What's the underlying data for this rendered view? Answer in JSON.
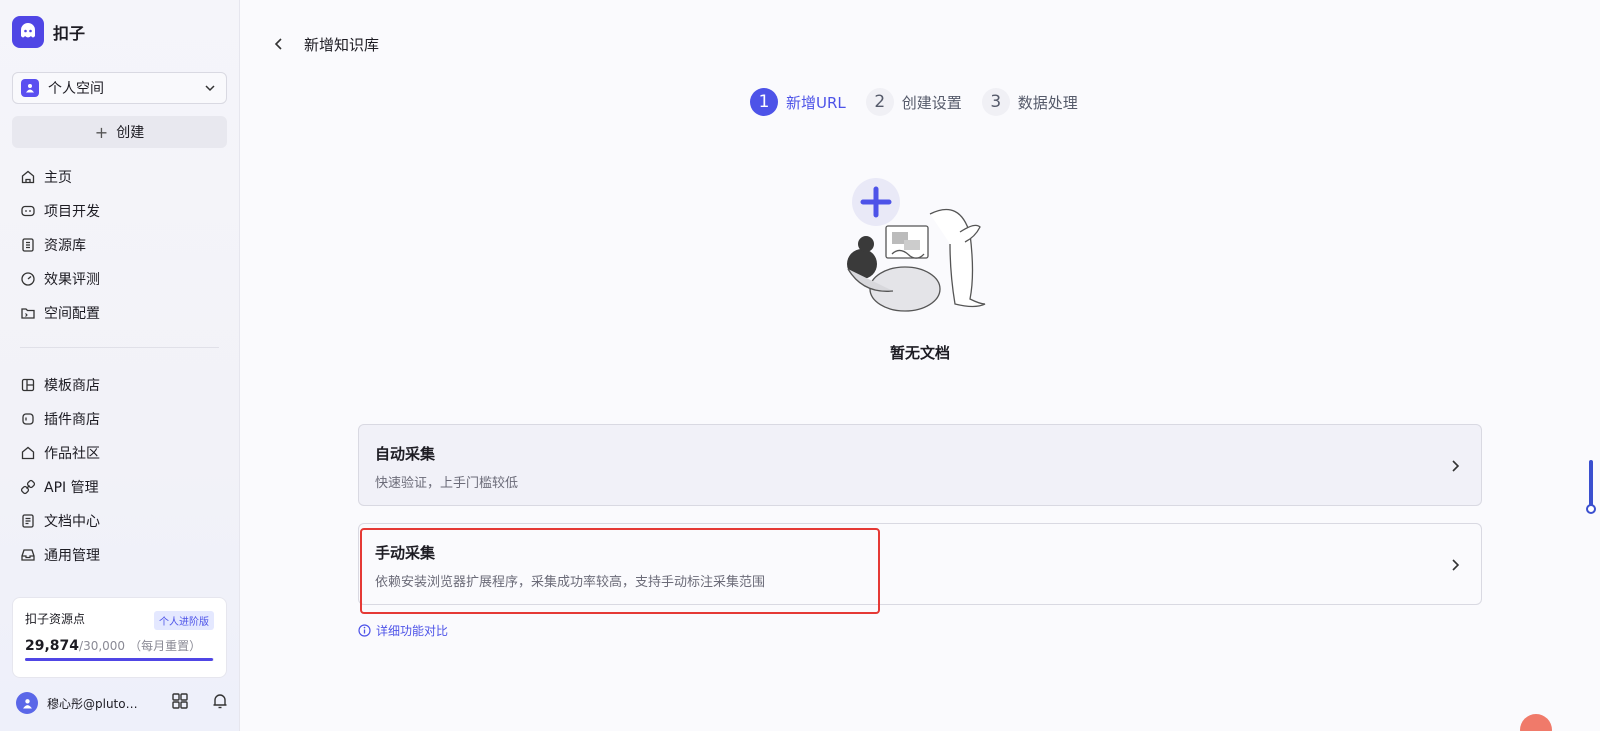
{
  "brand": {
    "name": "扣子"
  },
  "space": {
    "label": "个人空间"
  },
  "create": {
    "label": "创建"
  },
  "nav_primary": [
    {
      "label": "主页",
      "icon": "home-icon"
    },
    {
      "label": "项目开发",
      "icon": "robot-icon"
    },
    {
      "label": "资源库",
      "icon": "library-icon"
    },
    {
      "label": "效果评测",
      "icon": "gauge-icon"
    },
    {
      "label": "空间配置",
      "icon": "settings-folder-icon"
    }
  ],
  "nav_secondary": [
    {
      "label": "模板商店",
      "icon": "template-icon"
    },
    {
      "label": "插件商店",
      "icon": "plugin-icon"
    },
    {
      "label": "作品社区",
      "icon": "community-icon"
    },
    {
      "label": "API 管理",
      "icon": "api-icon"
    },
    {
      "label": "文档中心",
      "icon": "doc-icon"
    },
    {
      "label": "通用管理",
      "icon": "inbox-icon"
    }
  ],
  "points": {
    "title": "扣子资源点",
    "badge": "个人进阶版",
    "used": "29,874",
    "total": "/30,000",
    "reset": "（每月重置）",
    "fill_ratio": 0.9958,
    "accent": "#5046e5"
  },
  "user": {
    "name": "穆心彤@pluto…"
  },
  "page": {
    "title": "新增知识库"
  },
  "steps": [
    {
      "num": "1",
      "label": "新增URL",
      "active": true
    },
    {
      "num": "2",
      "label": "创建设置",
      "active": false
    },
    {
      "num": "3",
      "label": "数据处理",
      "active": false
    }
  ],
  "empty": {
    "text": "暂无文档"
  },
  "cards": {
    "auto": {
      "title": "自动采集",
      "desc": "快速验证，上手门槛较低"
    },
    "manual": {
      "title": "手动采集",
      "desc": "依赖安装浏览器扩展程序，采集成功率较高，支持手动标注采集范围"
    }
  },
  "compare": {
    "label": "详细功能对比"
  },
  "colors": {
    "accent": "#4d53e8",
    "highlight": "#e53935"
  }
}
